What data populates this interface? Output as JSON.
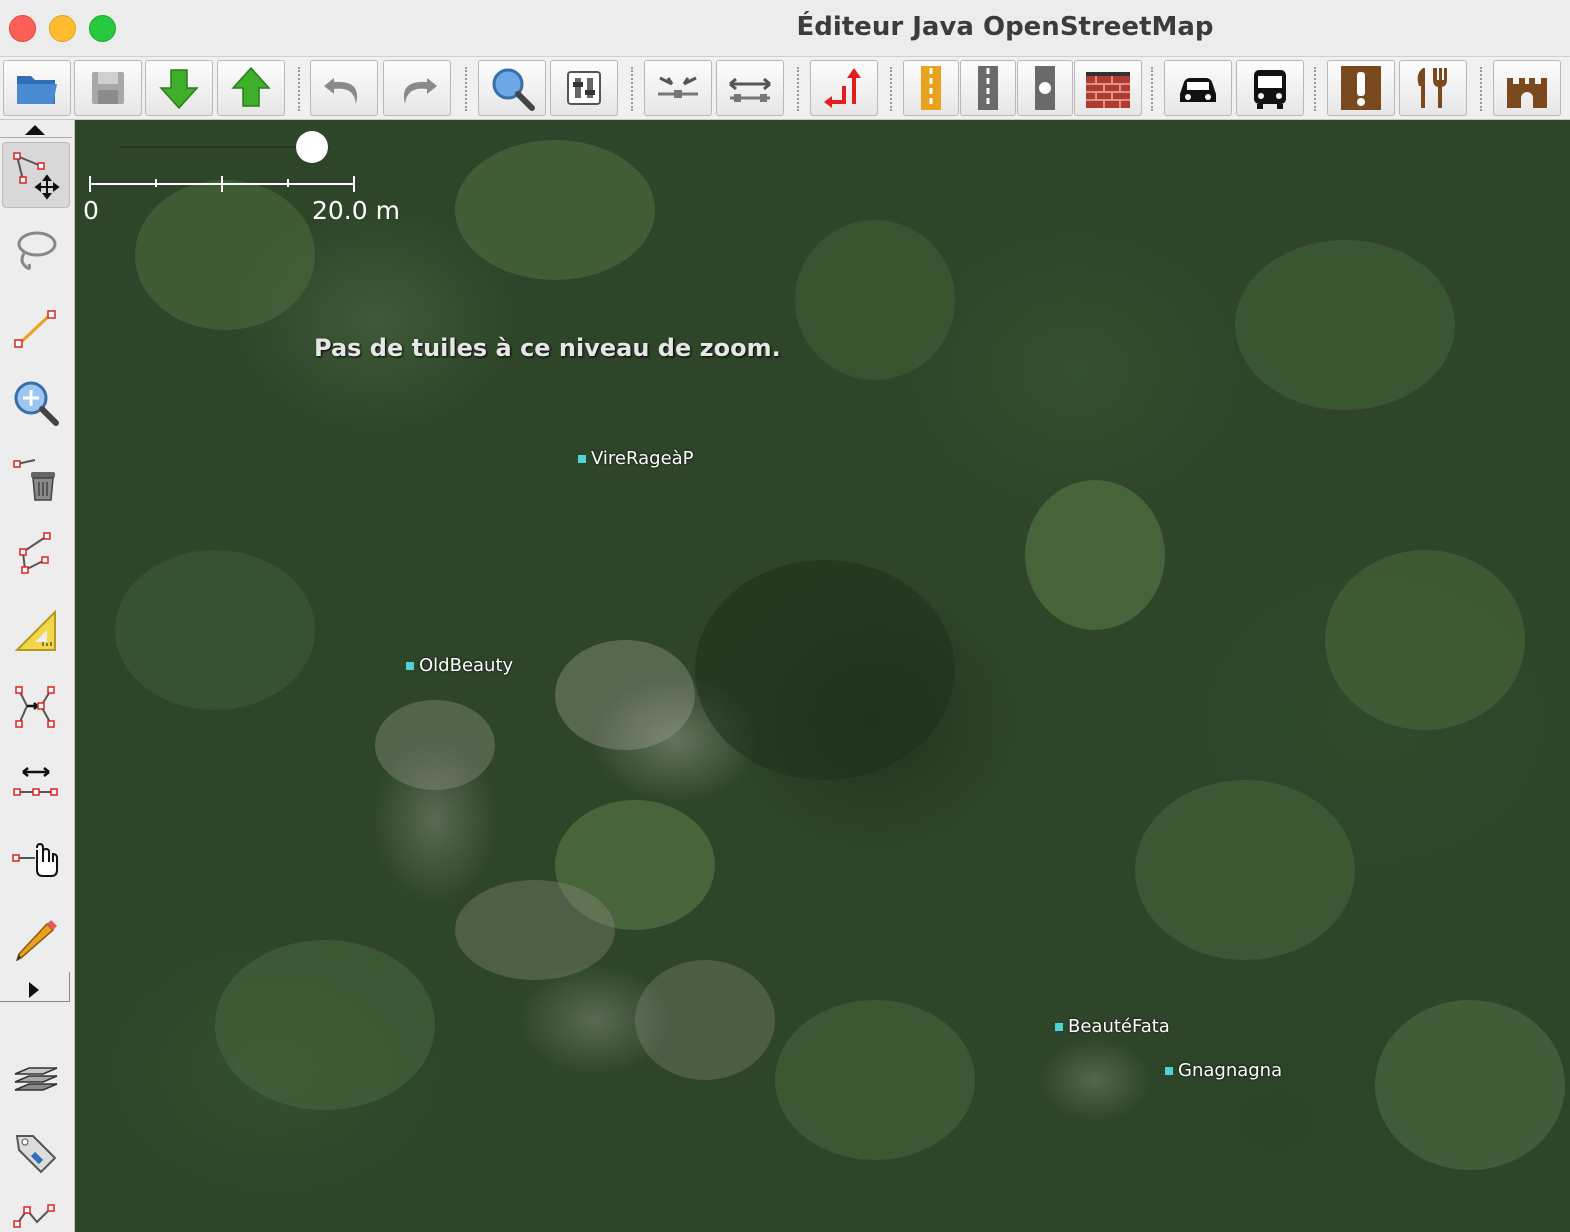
{
  "window": {
    "title": "Éditeur Java OpenStreetMap"
  },
  "map": {
    "scale": {
      "start_label": "0",
      "end_label": "20.0 m"
    },
    "message": "Pas de tuiles à ce niveau de zoom.",
    "nodes": [
      {
        "label": "VireRageàP"
      },
      {
        "label": "OldBeauty"
      },
      {
        "label": "BeautéFata"
      },
      {
        "label": "Gnagnagna"
      }
    ],
    "node_color": "#4fd3d9"
  },
  "colors": {
    "accent_download": "#3fae2a",
    "accent_warning": "#e8a21e",
    "poi_brown": "#7a4a1e"
  }
}
